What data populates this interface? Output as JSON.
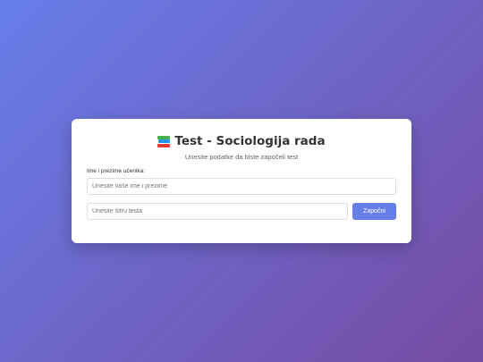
{
  "card": {
    "title_icon": "books-icon",
    "title": "Test - Sociologija rada",
    "subtitle": "Unesite podatke da biste započeli test"
  },
  "form": {
    "name_label": "Ime i prezime učenika:",
    "name_value": "",
    "name_placeholder": "Unesite vaše ime i prezime",
    "code_value": "",
    "code_placeholder": "Unesite šifru testa",
    "start_label": "Započni"
  },
  "colors": {
    "background_start": "#667eea",
    "background_end": "#764ba2",
    "button": "#667eea"
  }
}
